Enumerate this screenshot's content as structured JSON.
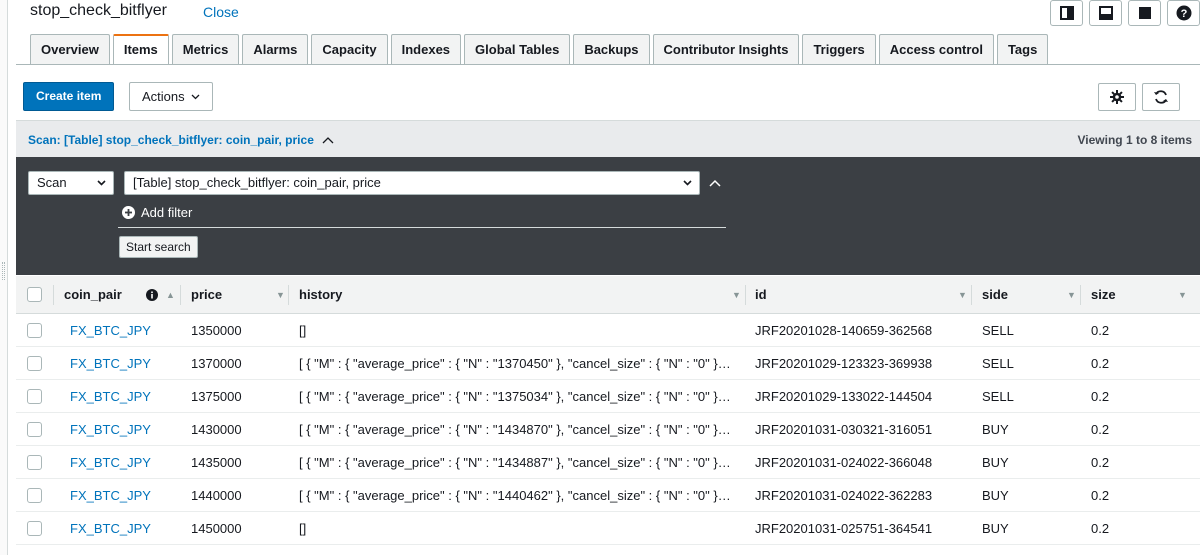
{
  "titlebar": {
    "table_name": "stop_check_bitflyer",
    "close_label": "Close"
  },
  "tabs": [
    {
      "label": "Overview",
      "active": false
    },
    {
      "label": "Items",
      "active": true
    },
    {
      "label": "Metrics",
      "active": false
    },
    {
      "label": "Alarms",
      "active": false
    },
    {
      "label": "Capacity",
      "active": false
    },
    {
      "label": "Indexes",
      "active": false
    },
    {
      "label": "Global Tables",
      "active": false
    },
    {
      "label": "Backups",
      "active": false
    },
    {
      "label": "Contributor Insights",
      "active": false
    },
    {
      "label": "Triggers",
      "active": false
    },
    {
      "label": "Access control",
      "active": false
    },
    {
      "label": "Tags",
      "active": false
    }
  ],
  "toolbar": {
    "create_label": "Create item",
    "actions_label": "Actions"
  },
  "scan": {
    "summary": "Scan: [Table] stop_check_bitflyer: coin_pair, price",
    "viewing": "Viewing 1 to 8 items",
    "mode_value": "Scan",
    "table_value": "[Table] stop_check_bitflyer: coin_pair, price",
    "add_filter_label": "Add filter",
    "start_label": "Start search"
  },
  "columns": {
    "coin_pair": "coin_pair",
    "price": "price",
    "history": "history",
    "id": "id",
    "side": "side",
    "size": "size"
  },
  "rows": [
    {
      "coin_pair": "FX_BTC_JPY",
      "price": "1350000",
      "history": "[]",
      "id": "JRF20201028-140659-362568",
      "side": "SELL",
      "size": "0.2"
    },
    {
      "coin_pair": "FX_BTC_JPY",
      "price": "1370000",
      "history": "[ { \"M\" : { \"average_price\" : { \"N\" : \"1370450\" }, \"cancel_size\" : { \"N\" : \"0\" }…",
      "id": "JRF20201029-123323-369938",
      "side": "SELL",
      "size": "0.2"
    },
    {
      "coin_pair": "FX_BTC_JPY",
      "price": "1375000",
      "history": "[ { \"M\" : { \"average_price\" : { \"N\" : \"1375034\" }, \"cancel_size\" : { \"N\" : \"0\" }…",
      "id": "JRF20201029-133022-144504",
      "side": "SELL",
      "size": "0.2"
    },
    {
      "coin_pair": "FX_BTC_JPY",
      "price": "1430000",
      "history": "[ { \"M\" : { \"average_price\" : { \"N\" : \"1434870\" }, \"cancel_size\" : { \"N\" : \"0\" }…",
      "id": "JRF20201031-030321-316051",
      "side": "BUY",
      "size": "0.2"
    },
    {
      "coin_pair": "FX_BTC_JPY",
      "price": "1435000",
      "history": "[ { \"M\" : { \"average_price\" : { \"N\" : \"1434887\" }, \"cancel_size\" : { \"N\" : \"0\" }…",
      "id": "JRF20201031-024022-366048",
      "side": "BUY",
      "size": "0.2"
    },
    {
      "coin_pair": "FX_BTC_JPY",
      "price": "1440000",
      "history": "[ { \"M\" : { \"average_price\" : { \"N\" : \"1440462\" }, \"cancel_size\" : { \"N\" : \"0\" }…",
      "id": "JRF20201031-024022-362283",
      "side": "BUY",
      "size": "0.2"
    },
    {
      "coin_pair": "FX_BTC_JPY",
      "price": "1450000",
      "history": "[]",
      "id": "JRF20201031-025751-364541",
      "side": "BUY",
      "size": "0.2"
    }
  ],
  "colors": {
    "accent": "#0073bb",
    "active_tab": "#ec7211",
    "panel": "#3b3f44"
  }
}
